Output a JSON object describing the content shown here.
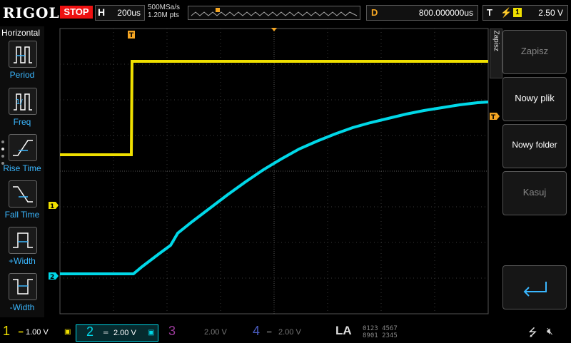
{
  "header": {
    "brand": "RIGOL",
    "run_state": "STOP",
    "timebase_label": "H",
    "timebase_value": "200us",
    "sample_rate": "500MSa/s",
    "memory_depth": "1.20M pts",
    "delay_label": "D",
    "delay_value": "800.000000us",
    "trigger_label": "T",
    "trigger_source": "1",
    "trigger_level": "2.50 V"
  },
  "left_menu": {
    "title": "Horizontal",
    "items": [
      {
        "label": "Period",
        "icon": "period-icon"
      },
      {
        "label": "Freq",
        "icon": "frequency-icon"
      },
      {
        "label": "Rise Time",
        "icon": "rise-time-icon"
      },
      {
        "label": "Fall Time",
        "icon": "fall-time-icon"
      },
      {
        "label": "+Width",
        "icon": "positive-width-icon"
      },
      {
        "label": "-Width",
        "icon": "negative-width-icon"
      }
    ]
  },
  "right_menu": {
    "tab_label": "Zapisz",
    "items": [
      {
        "label": "Zapisz",
        "enabled": false
      },
      {
        "label": "Nowy plik",
        "enabled": true
      },
      {
        "label": "Nowy folder",
        "enabled": true
      },
      {
        "label": "Kasuj",
        "enabled": false
      }
    ],
    "enter_icon": "enter-return-icon"
  },
  "markers": {
    "ch1": "1",
    "ch2": "2",
    "trigger_time": "T",
    "trigger_level": "T"
  },
  "channels": [
    {
      "num": "1",
      "scale": "1.00 V",
      "color": "#f0e000",
      "active": true
    },
    {
      "num": "2",
      "scale": "2.00 V",
      "color": "#00d8e8",
      "active": true
    },
    {
      "num": "3",
      "scale": "2.00 V",
      "color": "#c040c0",
      "active": false
    },
    {
      "num": "4",
      "scale": "2.00 V",
      "color": "#4060e0",
      "active": false
    }
  ],
  "la": {
    "label": "LA",
    "row1": "0123 4567",
    "row2": "8901 2345"
  },
  "status_icons": [
    "usb-icon",
    "sound-muted-icon"
  ],
  "colors": {
    "ch1": "#f0e000",
    "ch2": "#00d8e8",
    "stop": "#e11111",
    "trigger": "#f5a623",
    "grid": "#2a2a2a",
    "menu_text": "#3ab7ff"
  }
}
